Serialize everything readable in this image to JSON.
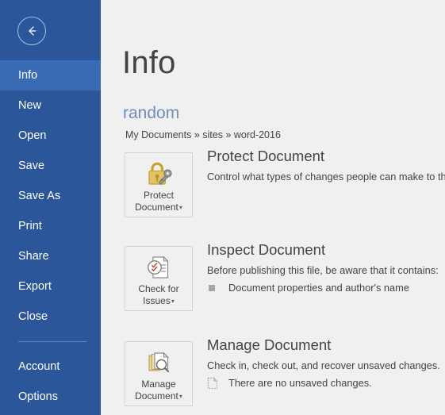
{
  "sidebar": {
    "back_button": {
      "icon": "back-arrow-icon",
      "label": "Back"
    },
    "items": [
      {
        "label": "Info",
        "selected": true
      },
      {
        "label": "New",
        "selected": false
      },
      {
        "label": "Open",
        "selected": false
      },
      {
        "label": "Save",
        "selected": false
      },
      {
        "label": "Save As",
        "selected": false
      },
      {
        "label": "Print",
        "selected": false
      },
      {
        "label": "Share",
        "selected": false
      },
      {
        "label": "Export",
        "selected": false
      },
      {
        "label": "Close",
        "selected": false
      }
    ],
    "footer_items": [
      {
        "label": "Account"
      },
      {
        "label": "Options"
      }
    ],
    "colors": {
      "background": "#2b579a",
      "selected_background": "#3a6bb5",
      "text": "#ffffff",
      "separator": "#5a83bf"
    }
  },
  "main": {
    "page_title": "Info",
    "document_name": "random",
    "breadcrumb": "My Documents » sites » word-2016",
    "colors": {
      "background": "#f0f0f0",
      "heading": "#444444",
      "document_name": "#6d8ebf",
      "button_border": "#d3d3d3",
      "icon_gold": "#c9a227",
      "icon_gray": "#808080"
    },
    "sections": [
      {
        "id": "protect-document",
        "button_label_line1": "Protect",
        "button_label_line2": "Document",
        "button_caret": "▾",
        "button_icon": "padlock-key-icon",
        "title": "Protect Document",
        "description": "Control what types of changes people can make to this",
        "items": []
      },
      {
        "id": "inspect-document",
        "button_label_line1": "Check for",
        "button_label_line2": "Issues",
        "button_caret": "▾",
        "button_icon": "document-inspect-icon",
        "title": "Inspect Document",
        "description": "Before publishing this file, be aware that it contains:",
        "items": [
          {
            "bullet": "square-bullet-icon",
            "text": "Document properties and author's name"
          }
        ]
      },
      {
        "id": "manage-document",
        "button_label_line1": "Manage",
        "button_label_line2": "Document",
        "button_caret": "▾",
        "button_icon": "document-stack-search-icon",
        "title": "Manage Document",
        "description": "Check in, check out, and recover unsaved changes.",
        "items": [
          {
            "bullet": "dotted-document-icon",
            "text": "There are no unsaved changes."
          }
        ]
      }
    ]
  }
}
